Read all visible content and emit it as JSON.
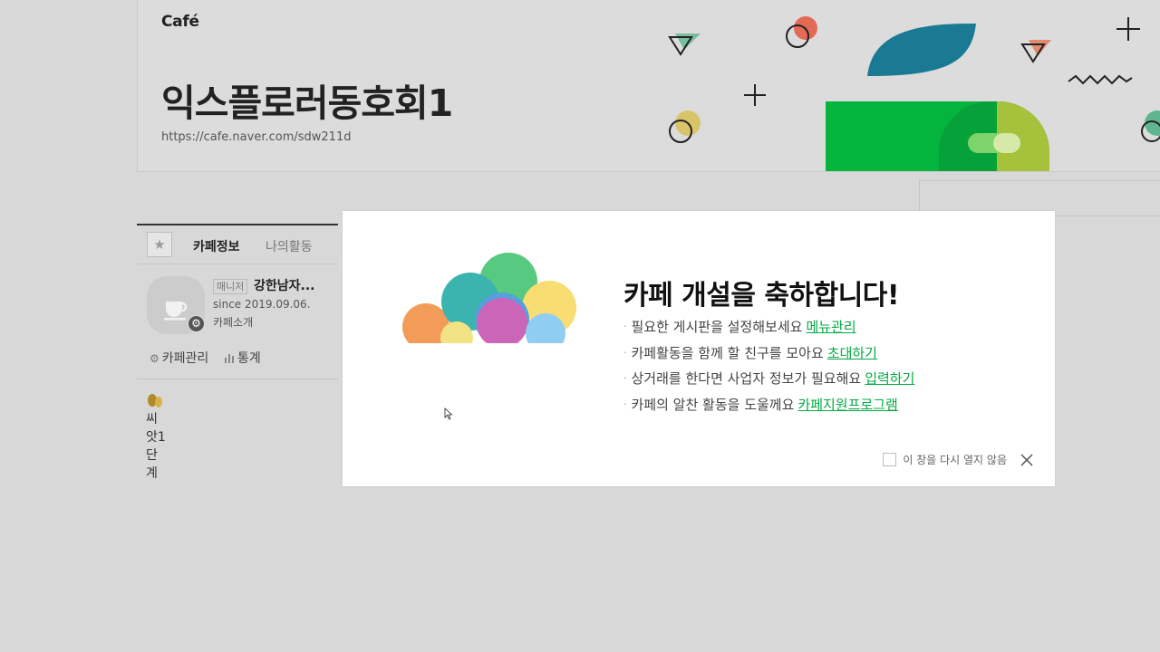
{
  "header": {
    "logo": "Café",
    "title": "익스플로러동호회1",
    "url": "https://cafe.naver.com/sdw211d"
  },
  "sidebar": {
    "tabs": [
      "카페정보",
      "나의활동"
    ],
    "star_icon": "★",
    "profile": {
      "manager_tag": "매니저",
      "manager_name": "강한남자...",
      "since": "since 2019.09.06.",
      "intro_link": "카페소개"
    },
    "links": {
      "admin": "카페관리",
      "stats": "통계"
    },
    "level": "씨앗1단계"
  },
  "modal": {
    "title": "카페 개설을 축하합니다!",
    "items": [
      {
        "text": "필요한 게시판을 설정해보세요",
        "link": "메뉴관리"
      },
      {
        "text": "카페활동을 함께 할 친구를 모아요",
        "link": "초대하기"
      },
      {
        "text": "상거래를 한다면 사업자 정보가 필요해요",
        "link": "입력하기"
      },
      {
        "text": "카페의 알찬 활동을 도울께요",
        "link": "카페지원프로그램"
      }
    ],
    "dont_show_again": "이 창을 다시 열지 않음"
  },
  "colors": {
    "accent_green": "#03a942",
    "brand_green": "#03b43d",
    "teal": "#1a7a94",
    "olive": "#a6c23a"
  }
}
